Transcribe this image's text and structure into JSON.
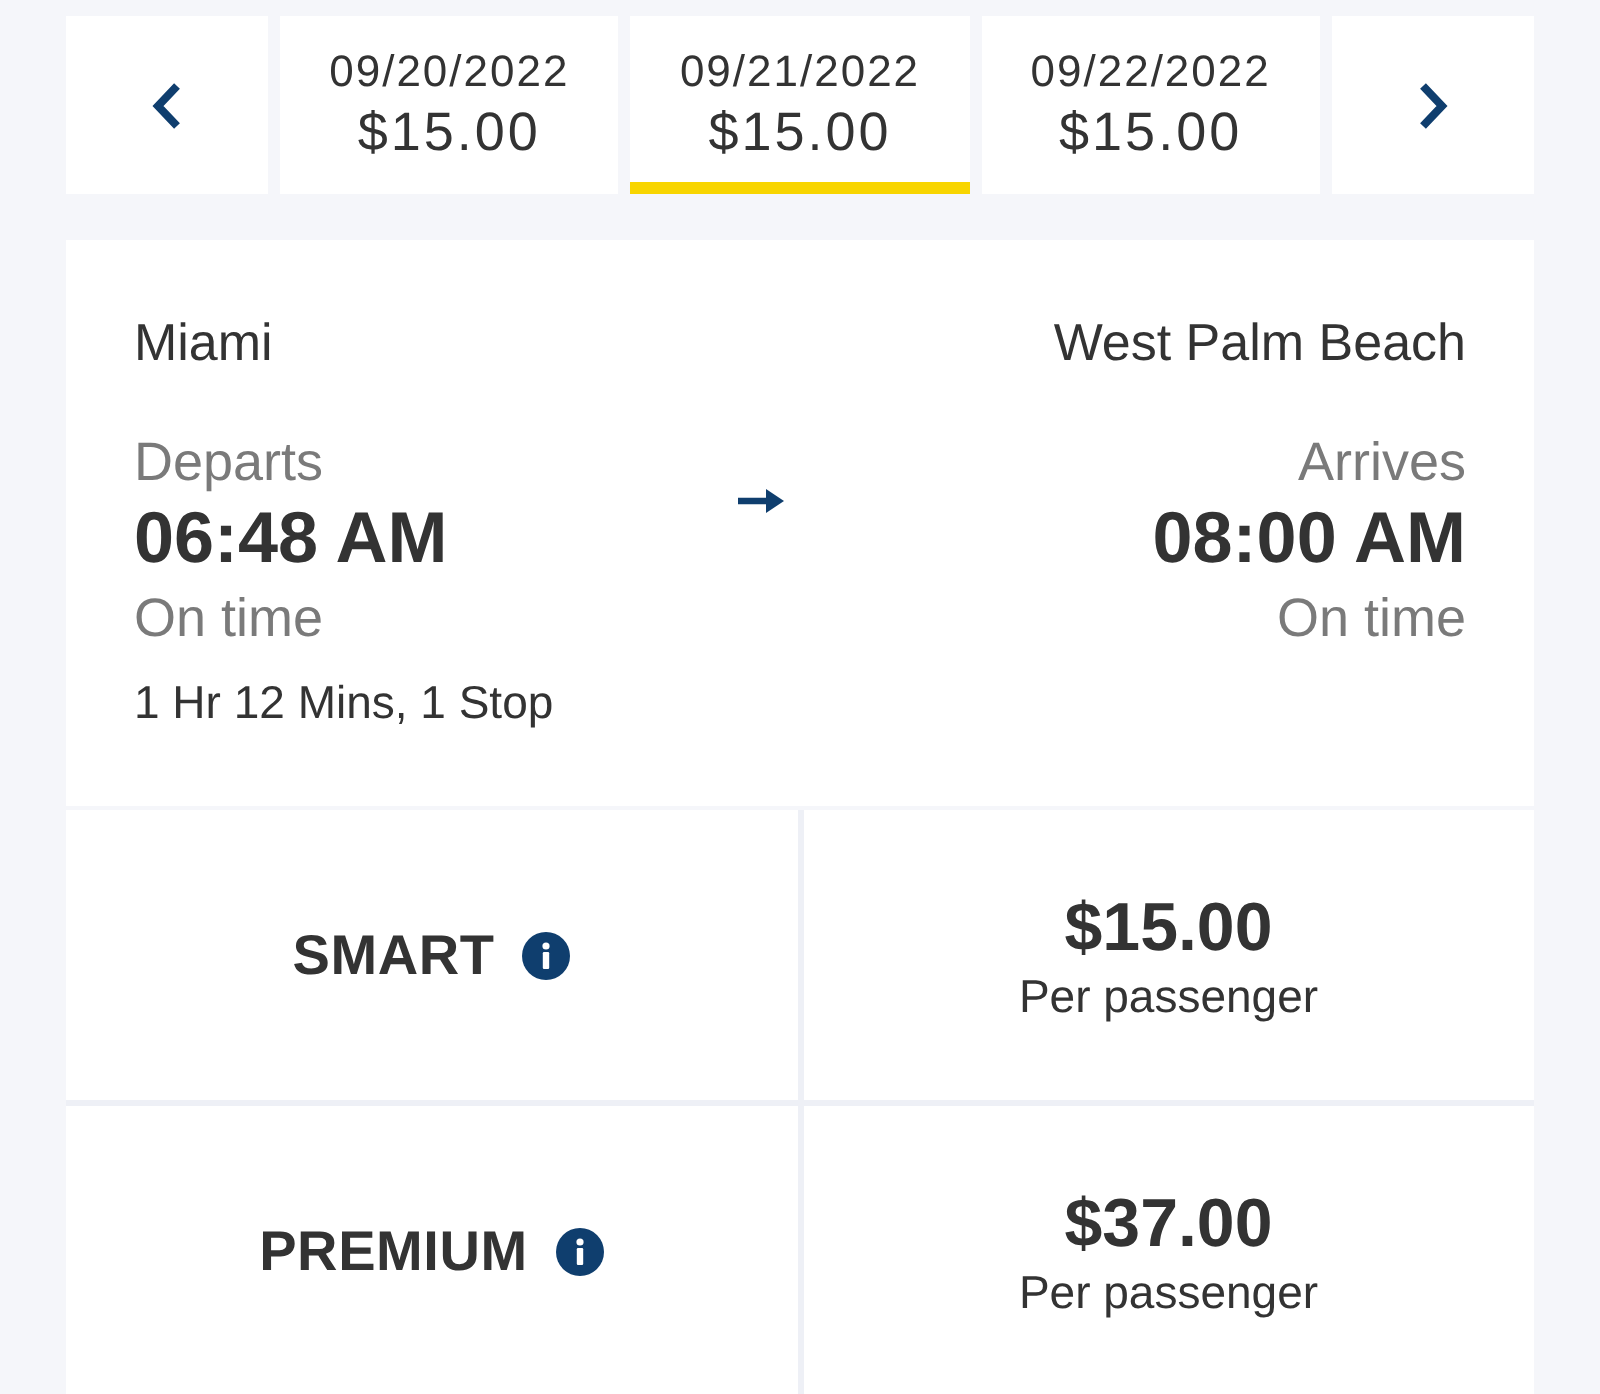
{
  "date_nav": {
    "dates": [
      {
        "date": "09/20/2022",
        "price": "$15.00",
        "selected": false
      },
      {
        "date": "09/21/2022",
        "price": "$15.00",
        "selected": true
      },
      {
        "date": "09/22/2022",
        "price": "$15.00",
        "selected": false
      }
    ]
  },
  "trip": {
    "origin": {
      "city": "Miami",
      "label": "Departs",
      "time": "06:48 AM",
      "status": "On time"
    },
    "destination": {
      "city": "West Palm Beach",
      "label": "Arrives",
      "time": "08:00 AM",
      "status": "On time"
    },
    "duration": "1 Hr 12 Mins, 1 Stop"
  },
  "fares": [
    {
      "name": "SMART",
      "price": "$15.00",
      "note": "Per passenger"
    },
    {
      "name": "PREMIUM",
      "price": "$37.00",
      "note": "Per passenger"
    }
  ]
}
